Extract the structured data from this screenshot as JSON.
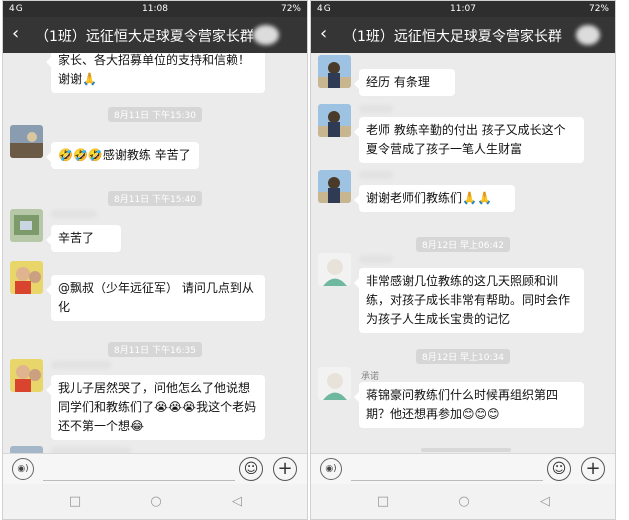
{
  "left": {
    "status": {
      "carrier": "4G",
      "time": "11:08",
      "battery": "72%"
    },
    "title": "（1班）远征恒大足球夏令营家长群",
    "messages": {
      "m1": "家长、各大招募单位的支持和信赖！谢谢🙏",
      "t1": "8月11日 下午15:30",
      "m2": "🤣🤣🤣感谢教练 辛苦了",
      "t2": "8月11日 下午15:40",
      "m3": "辛苦了",
      "m4": "@飘叔（少年远征军） 请问几点到从化",
      "t3": "8月11日 下午16:35",
      "m5": "我儿子居然哭了，问他怎么了他说想同学们和教练们了😭😭😭我这个老妈还不第一个想😂"
    }
  },
  "right": {
    "status": {
      "carrier": "4G",
      "time": "11:07",
      "battery": "72%"
    },
    "title": "（1班）远征恒大足球夏令营家长群",
    "messages": {
      "m1": "经历 有条理",
      "m2": "老师 教练辛勤的付出 孩子又成长这个夏令营成了孩子一笔人生财富",
      "m3": "谢谢老师们教练们🙏🙏",
      "t1": "8月12日 早上06:42",
      "m4": "非常感谢几位教练的这几天照顾和训练，对孩子成长非常有帮助。同时会作为孩子人生成长宝贵的记忆",
      "t2": "8月12日 早上10:34",
      "sender": "承诺",
      "m5": "蒋锦豪问教练们什么时候再组织第四期？他还想再参加😊😊😊"
    }
  },
  "icons": {
    "back": "‹",
    "voice": "◉)",
    "emoji": "☺",
    "plus": "+",
    "nav_square": "□",
    "nav_circle": "○",
    "nav_back": "◁"
  },
  "colors": {
    "titlebar": "#353535",
    "chat_bg": "#ebebeb",
    "bubble": "#ffffff"
  }
}
